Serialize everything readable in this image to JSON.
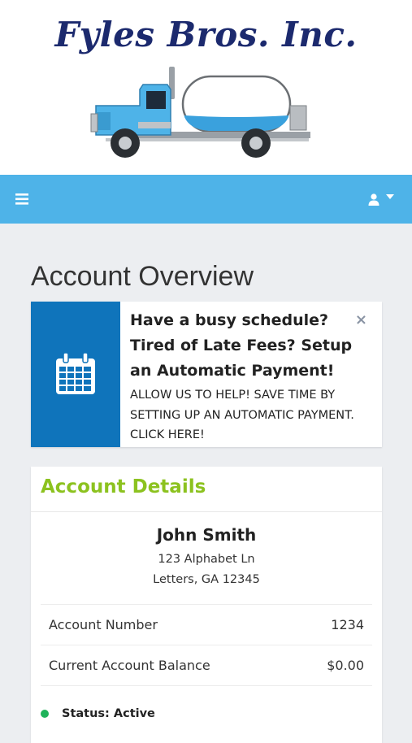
{
  "brand": {
    "name": "Fyles Bros. Inc.",
    "logo_color": "#1c2a6e"
  },
  "navbar": {
    "background": "#4eb3e8",
    "menu_icon": "hamburger-icon",
    "user_icon": "user-icon",
    "caret_icon": "caret-down-icon"
  },
  "page": {
    "title": "Account Overview"
  },
  "promo": {
    "icon": "calendar-icon",
    "heading": "Have a busy schedule? Tired of Late Fees? Setup an Automatic Payment!",
    "description": "ALLOW US TO HELP! SAVE TIME BY SETTING UP AN AUTOMATIC PAYMENT. CLICK HERE!",
    "close_label": "×"
  },
  "account_details": {
    "title": "Account Details",
    "title_color": "#8cc21f",
    "customer": {
      "name": "John Smith",
      "address_line1": "123 Alphabet Ln",
      "address_line2": "Letters, GA 12345"
    },
    "rows": [
      {
        "label": "Account Number",
        "value": "1234"
      },
      {
        "label": "Current Account Balance",
        "value": "$0.00"
      }
    ],
    "status": {
      "text": "Status: Active",
      "color": "#1fb35a"
    }
  }
}
